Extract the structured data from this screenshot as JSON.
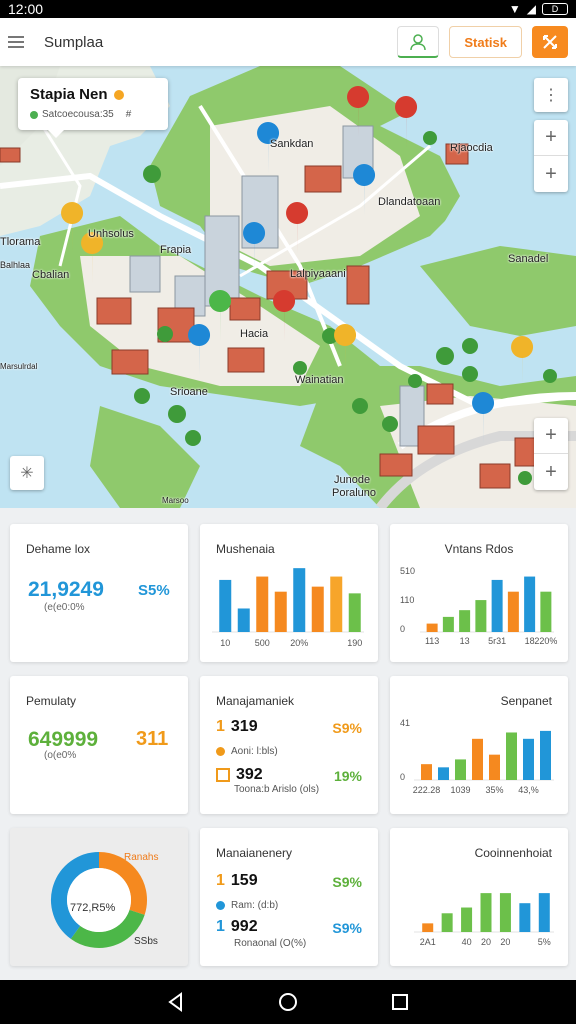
{
  "status": {
    "time": "12:00"
  },
  "appbar": {
    "title": "Sumplaa",
    "static_label": "Statisk"
  },
  "map": {
    "card": {
      "name": "Stapia Nen",
      "sub": "Satcoecousa:35",
      "sub2": "#"
    },
    "labels": [
      {
        "text": "Sankdan",
        "pos": "l1"
      },
      {
        "text": "Unhsolus",
        "pos": "l2"
      },
      {
        "text": "Frapia",
        "pos": "l3"
      },
      {
        "text": "Tlorama",
        "pos": "l4"
      },
      {
        "text": "Cbalian",
        "pos": "l5"
      },
      {
        "text": "Sanadel",
        "pos": "l6"
      },
      {
        "text": "Rjaocdia",
        "pos": "l7"
      },
      {
        "text": "Lalpiyaaani",
        "pos": "l8"
      },
      {
        "text": "Dlandatoaan",
        "pos": "l9"
      },
      {
        "text": "Balhlaa",
        "pos": "l10"
      },
      {
        "text": "Hacia",
        "pos": "l11"
      },
      {
        "text": "Srioane",
        "pos": "l12"
      },
      {
        "text": "Wainatian",
        "pos": "l13"
      },
      {
        "text": "Marsulrdal",
        "pos": "l14"
      },
      {
        "text": "Junode",
        "pos": "l15"
      },
      {
        "text": "Poraluno",
        "pos": "l16"
      },
      {
        "text": "Marsoo",
        "pos": "l17"
      }
    ]
  },
  "cards": {
    "c1": {
      "title": "Dehame lox",
      "value": "21,9249",
      "pct": "S5%",
      "sub": "(e(e0:0%"
    },
    "c2": {
      "title": "Mushenaia"
    },
    "c3": {
      "title": "Vntans Rdos"
    },
    "c4": {
      "title": "Pemulaty",
      "value": "649999",
      "value2": "311",
      "sub": "(o(e0%"
    },
    "c5": {
      "title": "Manajamaniek",
      "r1n": "1",
      "r1v": "319",
      "r1p": "S9%",
      "s1": "Aoni: l:bls)",
      "r2n": "",
      "r2v": "392",
      "r2p": "19%",
      "s2": "Toona:b Arislo (ols)"
    },
    "c6": {
      "title": "Senpanet"
    },
    "c7": {
      "label_top": "Ranahs",
      "center": "772,R5%",
      "label_bot": "SSbs"
    },
    "c8": {
      "title": "Manaianenery",
      "r1n": "1",
      "r1v": "159",
      "r1p": "S9%",
      "s1": "Ram: (d:b)",
      "r2n": "1",
      "r2v": "992",
      "r2p": "S9%",
      "s2": "Ronaonal (O(%)"
    },
    "c9": {
      "title": "Cooinnenhoiat"
    }
  },
  "chart_data": [
    {
      "type": "bar",
      "title": "Mushenaia",
      "categories": [
        "10",
        "",
        "500",
        "",
        "20%",
        "",
        "",
        "190"
      ],
      "values": [
        62,
        28,
        66,
        48,
        76,
        54,
        66,
        46
      ],
      "colors": [
        "#2196d8",
        "#2196d8",
        "#f5891f",
        "#f5891f",
        "#2196d8",
        "#f5891f",
        "#f7a52a",
        "#6cc04a"
      ],
      "ylim": [
        0,
        100
      ]
    },
    {
      "type": "bar",
      "title": "Vntans Rdos",
      "yticks": [
        "510",
        "110",
        "0"
      ],
      "categories": [
        "113",
        "",
        "13",
        "",
        "5r31",
        "",
        "18",
        "220%"
      ],
      "values": [
        10,
        18,
        26,
        38,
        62,
        48,
        66,
        48
      ],
      "colors": [
        "#f5891f",
        "#6cc04a",
        "#6cc04a",
        "#6cc04a",
        "#2196d8",
        "#f5891f",
        "#2196d8",
        "#6cc04a"
      ],
      "ylim": [
        0,
        100
      ]
    },
    {
      "type": "bar",
      "title": "Senpanet",
      "yticks": [
        "41",
        "0"
      ],
      "categories": [
        "222.28",
        "",
        "1039",
        "",
        "35%",
        "",
        "43,%"
      ],
      "values": [
        20,
        16,
        26,
        52,
        32,
        60,
        52,
        62
      ],
      "colors": [
        "#f5891f",
        "#2196d8",
        "#6cc04a",
        "#f5891f",
        "#f5891f",
        "#6cc04a",
        "#2196d8",
        "#2196d8"
      ],
      "ylim": [
        0,
        100
      ]
    },
    {
      "type": "bar",
      "title": "Cooinnenhoiat",
      "categories": [
        "2A1",
        "",
        "40",
        "20",
        "20",
        "",
        "5%"
      ],
      "values": [
        12,
        26,
        34,
        54,
        54,
        40,
        54
      ],
      "colors": [
        "#f5891f",
        "#6cc04a",
        "#6cc04a",
        "#6cc04a",
        "#6cc04a",
        "#2196d8",
        "#2196d8"
      ],
      "ylim": [
        0,
        100
      ]
    },
    {
      "type": "pie",
      "title": "",
      "values": [
        30,
        30,
        40
      ],
      "colors": [
        "#f5891f",
        "#4cb748",
        "#2196d8"
      ],
      "center_label": "772,R5%"
    }
  ]
}
